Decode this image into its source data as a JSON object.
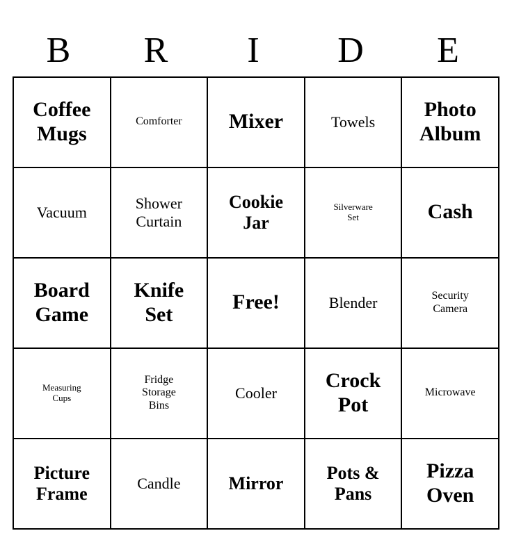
{
  "header": {
    "letters": [
      "B",
      "R",
      "I",
      "D",
      "E"
    ]
  },
  "grid": [
    [
      {
        "text": "Coffee\nMugs",
        "size": "xl"
      },
      {
        "text": "Comforter",
        "size": "sm"
      },
      {
        "text": "Mixer",
        "size": "xl"
      },
      {
        "text": "Towels",
        "size": "md"
      },
      {
        "text": "Photo\nAlbum",
        "size": "xl"
      }
    ],
    [
      {
        "text": "Vacuum",
        "size": "md"
      },
      {
        "text": "Shower\nCurtain",
        "size": "md"
      },
      {
        "text": "Cookie\nJar",
        "size": "lg"
      },
      {
        "text": "Silverware\nSet",
        "size": "xs"
      },
      {
        "text": "Cash",
        "size": "xl"
      }
    ],
    [
      {
        "text": "Board\nGame",
        "size": "xl"
      },
      {
        "text": "Knife\nSet",
        "size": "xl"
      },
      {
        "text": "Free!",
        "size": "xl"
      },
      {
        "text": "Blender",
        "size": "md"
      },
      {
        "text": "Security\nCamera",
        "size": "sm"
      }
    ],
    [
      {
        "text": "Measuring\nCups",
        "size": "xs"
      },
      {
        "text": "Fridge\nStorage\nBins",
        "size": "sm"
      },
      {
        "text": "Cooler",
        "size": "md"
      },
      {
        "text": "Crock\nPot",
        "size": "xl"
      },
      {
        "text": "Microwave",
        "size": "sm"
      }
    ],
    [
      {
        "text": "Picture\nFrame",
        "size": "lg"
      },
      {
        "text": "Candle",
        "size": "md"
      },
      {
        "text": "Mirror",
        "size": "lg"
      },
      {
        "text": "Pots &\nPans",
        "size": "lg"
      },
      {
        "text": "Pizza\nOven",
        "size": "xl"
      }
    ]
  ]
}
